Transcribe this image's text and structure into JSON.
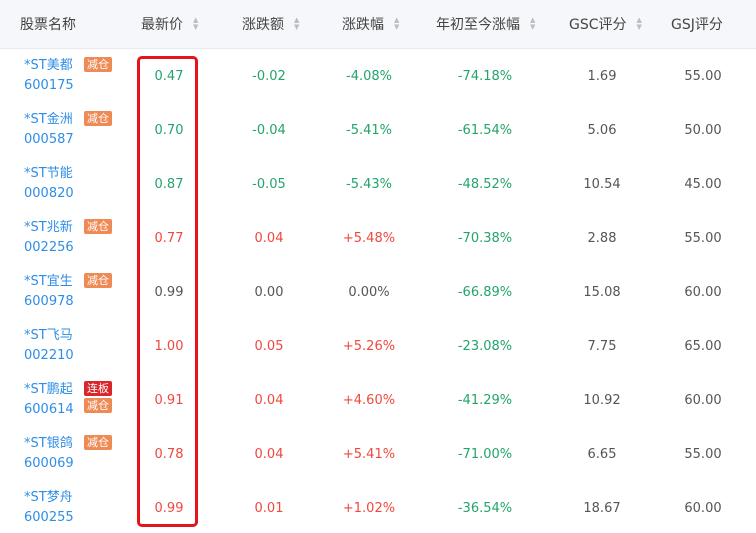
{
  "columns": [
    {
      "key": "name",
      "label": "股票名称",
      "sortable": false
    },
    {
      "key": "price",
      "label": "最新价",
      "sortable": true
    },
    {
      "key": "change",
      "label": "涨跌额",
      "sortable": true
    },
    {
      "key": "pct",
      "label": "涨跌幅",
      "sortable": true
    },
    {
      "key": "ytd",
      "label": "年初至今涨幅",
      "sortable": true
    },
    {
      "key": "gsc",
      "label": "GSC评分",
      "sortable": true
    },
    {
      "key": "gsj",
      "label": "GSJ评分",
      "sortable": false
    }
  ],
  "sort_icons": {
    "up": "▲",
    "down": "▼"
  },
  "rows": [
    {
      "name": "*ST美都",
      "code": "600175",
      "tags": [
        "减仓"
      ],
      "price": "0.47",
      "change": "-0.02",
      "pct": "-4.08%",
      "ytd": "-74.18%",
      "gsc": "1.69",
      "gsj": "55.00",
      "dir": "down"
    },
    {
      "name": "*ST金洲",
      "code": "000587",
      "tags": [
        "减仓"
      ],
      "price": "0.70",
      "change": "-0.04",
      "pct": "-5.41%",
      "ytd": "-61.54%",
      "gsc": "5.06",
      "gsj": "50.00",
      "dir": "down"
    },
    {
      "name": "*ST节能",
      "code": "000820",
      "tags": [],
      "price": "0.87",
      "change": "-0.05",
      "pct": "-5.43%",
      "ytd": "-48.52%",
      "gsc": "10.54",
      "gsj": "45.00",
      "dir": "down"
    },
    {
      "name": "*ST兆新",
      "code": "002256",
      "tags": [
        "减仓"
      ],
      "price": "0.77",
      "change": "0.04",
      "pct": "+5.48%",
      "ytd": "-70.38%",
      "gsc": "2.88",
      "gsj": "55.00",
      "dir": "up"
    },
    {
      "name": "*ST宜生",
      "code": "600978",
      "tags": [
        "减仓"
      ],
      "price": "0.99",
      "change": "0.00",
      "pct": "0.00%",
      "ytd": "-66.89%",
      "gsc": "15.08",
      "gsj": "60.00",
      "dir": "flat"
    },
    {
      "name": "*ST飞马",
      "code": "002210",
      "tags": [],
      "price": "1.00",
      "change": "0.05",
      "pct": "+5.26%",
      "ytd": "-23.08%",
      "gsc": "7.75",
      "gsj": "65.00",
      "dir": "up"
    },
    {
      "name": "*ST鹏起",
      "code": "600614",
      "tags": [
        "连板",
        "减仓"
      ],
      "price": "0.91",
      "change": "0.04",
      "pct": "+4.60%",
      "ytd": "-41.29%",
      "gsc": "10.92",
      "gsj": "60.00",
      "dir": "up"
    },
    {
      "name": "*ST银鸽",
      "code": "600069",
      "tags": [
        "减仓"
      ],
      "price": "0.78",
      "change": "0.04",
      "pct": "+5.41%",
      "ytd": "-71.00%",
      "gsc": "6.65",
      "gsj": "55.00",
      "dir": "up"
    },
    {
      "name": "*ST梦舟",
      "code": "600255",
      "tags": [],
      "price": "0.99",
      "change": "0.01",
      "pct": "+1.02%",
      "ytd": "-36.54%",
      "gsc": "18.67",
      "gsj": "60.00",
      "dir": "up"
    }
  ],
  "colors": {
    "up": "#f0483e",
    "down": "#23a46a",
    "link": "#2e8ee6",
    "tag_reduce": "#ee8a55",
    "tag_limit": "#d8262a",
    "highlight_border": "#e3141a"
  }
}
